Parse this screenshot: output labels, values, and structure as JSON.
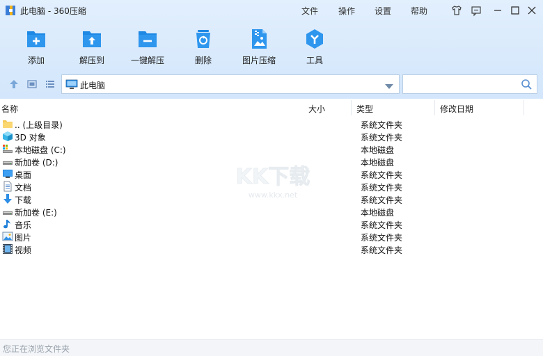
{
  "window": {
    "title": "此电脑 - 360压缩",
    "menu": [
      "文件",
      "操作",
      "设置",
      "帮助"
    ]
  },
  "toolbar": {
    "items": [
      {
        "label": "添加",
        "icon": "add-archive-icon"
      },
      {
        "label": "解压到",
        "icon": "extract-to-icon"
      },
      {
        "label": "一键解压",
        "icon": "one-click-extract-icon"
      },
      {
        "label": "删除",
        "icon": "recycle-bin-icon"
      },
      {
        "label": "图片压缩",
        "icon": "image-compress-icon"
      },
      {
        "label": "工具",
        "icon": "tools-icon"
      }
    ]
  },
  "address": {
    "path": "此电脑"
  },
  "search": {
    "value": "",
    "placeholder": ""
  },
  "columns": {
    "name": "名称",
    "size": "大小",
    "type": "类型",
    "modified": "修改日期"
  },
  "rows": [
    {
      "name": ".. (上级目录)",
      "type": "系统文件夹",
      "icon": "folder-up-icon"
    },
    {
      "name": "3D 对象",
      "type": "系统文件夹",
      "icon": "3d-objects-icon"
    },
    {
      "name": "本地磁盘 (C:)",
      "type": "本地磁盘",
      "icon": "system-drive-icon"
    },
    {
      "name": "新加卷 (D:)",
      "type": "本地磁盘",
      "icon": "drive-icon"
    },
    {
      "name": "桌面",
      "type": "系统文件夹",
      "icon": "desktop-icon"
    },
    {
      "name": "文档",
      "type": "系统文件夹",
      "icon": "documents-icon"
    },
    {
      "name": "下载",
      "type": "系统文件夹",
      "icon": "download-icon"
    },
    {
      "name": "新加卷 (E:)",
      "type": "本地磁盘",
      "icon": "drive-icon"
    },
    {
      "name": "音乐",
      "type": "系统文件夹",
      "icon": "music-icon"
    },
    {
      "name": "图片",
      "type": "系统文件夹",
      "icon": "pictures-icon"
    },
    {
      "name": "视频",
      "type": "系统文件夹",
      "icon": "videos-icon"
    }
  ],
  "watermark": {
    "brand": "KK下载",
    "url": "www.kkx.net"
  },
  "status": {
    "text": "您正在浏览文件夹"
  },
  "colors": {
    "accent": "#2b8ee8",
    "toolbar_bg": "#dbeafc"
  }
}
